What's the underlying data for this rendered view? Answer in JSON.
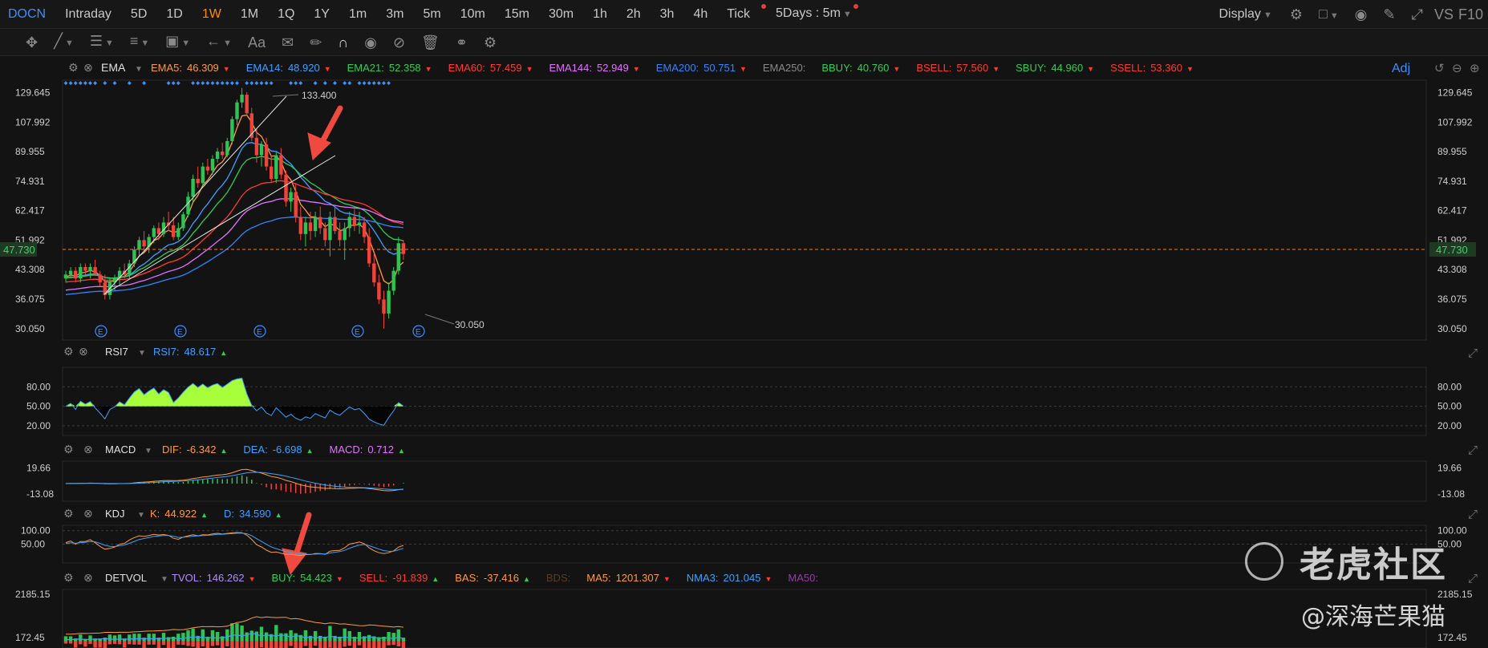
{
  "toolbar": {
    "symbol": "DOCN",
    "timeframes": [
      "Intraday",
      "5D",
      "1D",
      "1W",
      "1M",
      "1Q",
      "1Y",
      "1m",
      "3m",
      "5m",
      "10m",
      "15m",
      "30m",
      "1h",
      "2h",
      "3h",
      "4h",
      "Tick"
    ],
    "active": "1W",
    "period_select": "5Days : 5m",
    "display_label": "Display",
    "vs_label": "VS",
    "f10_label": "F10"
  },
  "drawing_tools": [
    "move-icon",
    "line-icon",
    "channel-icon",
    "fib-icon",
    "measure-icon",
    "arrow-icon",
    "text-icon",
    "note-icon",
    "pencil-icon",
    "magnet-icon",
    "eye-icon",
    "hide-icon",
    "trash-icon",
    "link-icon",
    "settings-icon"
  ],
  "main_indicator": {
    "name": "EMA",
    "adj_label": "Adj",
    "legend": [
      {
        "label": "EMA5:",
        "value": "46.309",
        "color": "#ff9a3c",
        "dir": "down"
      },
      {
        "label": "EMA14:",
        "value": "48.920",
        "color": "#3da0ff",
        "dir": "down"
      },
      {
        "label": "EMA21:",
        "value": "52.358",
        "color": "#33cc55",
        "dir": "down"
      },
      {
        "label": "EMA60:",
        "value": "57.459",
        "color": "#ff3b30",
        "dir": "down"
      },
      {
        "label": "EMA144:",
        "value": "52.949",
        "color": "#e272ff",
        "dir": "down"
      },
      {
        "label": "EMA200:",
        "value": "50.751",
        "color": "#2f86ff",
        "dir": "down"
      },
      {
        "label": "EMA250:",
        "value": "",
        "color": "#8a8a8a",
        "dir": ""
      },
      {
        "label": "BBUY:",
        "value": "40.760",
        "color": "#33cc55",
        "dir": "down"
      },
      {
        "label": "BSELL:",
        "value": "57.560",
        "color": "#ff3b30",
        "dir": "down"
      },
      {
        "label": "SBUY:",
        "value": "44.960",
        "color": "#33cc55",
        "dir": "down"
      },
      {
        "label": "SSELL:",
        "value": "53.360",
        "color": "#ff3b30",
        "dir": "down"
      }
    ],
    "price_ticks": [
      "129.645",
      "107.992",
      "89.955",
      "74.931",
      "62.417",
      "51.992",
      "43.308",
      "36.075",
      "30.050"
    ],
    "current_price": "47.730",
    "high_label": "133.400",
    "low_label": "30.050",
    "earnings_marker": "E"
  },
  "rsi": {
    "name": "RSI7",
    "legend": [
      {
        "label": "RSI7:",
        "value": "48.617",
        "color": "#3da0ff",
        "dir": "up"
      }
    ],
    "ticks": [
      "80.00",
      "50.00",
      "20.00"
    ]
  },
  "macd": {
    "name": "MACD",
    "legend": [
      {
        "label": "DIF:",
        "value": "-6.342",
        "color": "#ff9a3c",
        "dir": "up"
      },
      {
        "label": "DEA:",
        "value": "-6.698",
        "color": "#3da0ff",
        "dir": "up"
      },
      {
        "label": "MACD:",
        "value": "0.712",
        "color": "#e272ff",
        "dir": "up"
      }
    ],
    "ticks": [
      "19.66",
      "-13.08"
    ]
  },
  "kdj": {
    "name": "KDJ",
    "legend": [
      {
        "label": "K:",
        "value": "44.922",
        "color": "#ff9a3c",
        "dir": "up"
      },
      {
        "label": "D:",
        "value": "34.590",
        "color": "#3da0ff",
        "dir": "up"
      }
    ],
    "ticks": [
      "100.00",
      "50.00"
    ]
  },
  "detvol": {
    "name": "DETVOL",
    "legend": [
      {
        "label": "TVOL:",
        "value": "146.262",
        "color": "#b38cff",
        "dir": "down"
      },
      {
        "label": "BUY:",
        "value": "54.423",
        "color": "#33cc55",
        "dir": "down"
      },
      {
        "label": "SELL:",
        "value": "-91.839",
        "color": "#ff3b30",
        "dir": "up"
      },
      {
        "label": "BAS:",
        "value": "-37.416",
        "color": "#ff9a3c",
        "dir": "up"
      },
      {
        "label": "BDS:",
        "value": "",
        "color": "#5a3a2a",
        "dir": ""
      },
      {
        "label": "MA5:",
        "value": "1201.307",
        "color": "#ff9a3c",
        "dir": "down"
      },
      {
        "label": "NMA3:",
        "value": "201.045",
        "color": "#3da0ff",
        "dir": "down"
      },
      {
        "label": "MA50:",
        "value": "",
        "color": "#9a3aaa",
        "dir": ""
      }
    ],
    "ticks": [
      "2185.15",
      "172.45"
    ]
  },
  "watermark": {
    "brand": "老虎社区",
    "handle": "@深海芒果猫"
  },
  "chart_data": {
    "type": "candlestick",
    "title": "DOCN",
    "interval": "1W",
    "ylim": [
      28,
      140
    ],
    "y_scale": "log",
    "candles": [
      [
        41,
        43,
        40,
        42
      ],
      [
        42,
        44,
        41,
        43
      ],
      [
        43,
        44,
        40,
        41
      ],
      [
        41,
        45,
        40,
        44
      ],
      [
        44,
        45,
        42,
        43
      ],
      [
        43,
        45,
        41,
        44
      ],
      [
        44,
        46,
        42,
        42
      ],
      [
        42,
        43,
        39,
        40
      ],
      [
        40,
        42,
        36,
        37
      ],
      [
        37,
        41,
        36,
        40
      ],
      [
        40,
        42,
        38,
        41
      ],
      [
        41,
        44,
        39,
        43
      ],
      [
        43,
        45,
        41,
        42
      ],
      [
        42,
        46,
        41,
        45
      ],
      [
        45,
        50,
        44,
        49
      ],
      [
        49,
        53,
        47,
        52
      ],
      [
        52,
        55,
        49,
        50
      ],
      [
        50,
        54,
        48,
        53
      ],
      [
        53,
        57,
        51,
        56
      ],
      [
        56,
        58,
        52,
        54
      ],
      [
        54,
        60,
        53,
        58
      ],
      [
        58,
        62,
        55,
        57
      ],
      [
        57,
        60,
        52,
        53
      ],
      [
        53,
        58,
        52,
        56
      ],
      [
        56,
        62,
        55,
        61
      ],
      [
        61,
        70,
        60,
        68
      ],
      [
        68,
        78,
        66,
        76
      ],
      [
        76,
        82,
        72,
        74
      ],
      [
        74,
        84,
        73,
        82
      ],
      [
        82,
        86,
        78,
        80
      ],
      [
        80,
        88,
        78,
        86
      ],
      [
        86,
        92,
        84,
        90
      ],
      [
        90,
        95,
        86,
        88
      ],
      [
        88,
        98,
        87,
        96
      ],
      [
        96,
        112,
        94,
        110
      ],
      [
        110,
        124,
        106,
        122
      ],
      [
        122,
        133.4,
        118,
        128
      ],
      [
        128,
        130,
        112,
        114
      ],
      [
        114,
        118,
        96,
        98
      ],
      [
        98,
        104,
        84,
        88
      ],
      [
        88,
        96,
        82,
        94
      ],
      [
        94,
        98,
        80,
        82
      ],
      [
        82,
        88,
        74,
        76
      ],
      [
        76,
        90,
        74,
        88
      ],
      [
        88,
        92,
        76,
        78
      ],
      [
        78,
        80,
        64,
        66
      ],
      [
        66,
        72,
        62,
        70
      ],
      [
        70,
        74,
        58,
        60
      ],
      [
        60,
        64,
        52,
        54
      ],
      [
        54,
        60,
        50,
        58
      ],
      [
        58,
        62,
        52,
        55
      ],
      [
        55,
        62,
        53,
        60
      ],
      [
        60,
        64,
        54,
        56
      ],
      [
        56,
        58,
        50,
        52
      ],
      [
        52,
        62,
        47,
        60
      ],
      [
        60,
        64,
        54,
        55
      ],
      [
        55,
        58,
        50,
        52
      ],
      [
        52,
        58,
        46,
        56
      ],
      [
        56,
        62,
        53,
        60
      ],
      [
        60,
        63,
        55,
        57
      ],
      [
        57,
        62,
        54,
        58
      ],
      [
        58,
        60,
        51,
        53
      ],
      [
        53,
        56,
        44,
        45
      ],
      [
        45,
        48,
        39,
        40
      ],
      [
        40,
        42,
        35,
        36
      ],
      [
        36,
        38,
        30.05,
        33
      ],
      [
        33,
        40,
        32,
        38
      ],
      [
        38,
        44,
        37,
        43
      ],
      [
        43,
        53,
        42,
        51
      ],
      [
        51,
        52,
        46,
        47.73
      ]
    ],
    "ema": [
      {
        "name": "EMA5",
        "color": "#ff9a3c",
        "last": 46.309
      },
      {
        "name": "EMA14",
        "color": "#3da0ff",
        "last": 48.92
      },
      {
        "name": "EMA21",
        "color": "#33cc55",
        "last": 52.358
      },
      {
        "name": "EMA60",
        "color": "#ff3b30",
        "last": 57.459
      },
      {
        "name": "EMA144",
        "color": "#e272ff",
        "last": 52.949
      },
      {
        "name": "EMA200",
        "color": "#2f86ff",
        "last": 50.751
      }
    ],
    "earnings_weeks": [
      2,
      7,
      13,
      20,
      26
    ],
    "rsi_last": 48.617,
    "macd_last": {
      "dif": -6.342,
      "dea": -6.698,
      "macd": 0.712
    },
    "kdj_last": {
      "k": 44.922,
      "d": 34.59
    },
    "detvol_ylim": [
      -300,
      2400
    ]
  }
}
